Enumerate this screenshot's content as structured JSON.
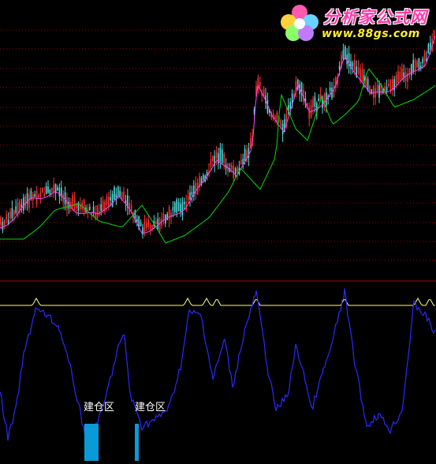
{
  "branding": {
    "site_name": "分析家公式网",
    "site_url": "www.88gs.com"
  },
  "signals": {
    "zone_label_1": "建仓区",
    "zone_label_2": "建仓区"
  },
  "colors": {
    "background": "#000000",
    "candle_up": "#ff3232",
    "candle_down": "#50e0e0",
    "ma_short": "#ff40ff",
    "ma_long": "#00dd00",
    "divider": "#b00000",
    "grid_dots": "#a00000",
    "oscillator": "#2a2aff",
    "ceiling_line": "#ffff80",
    "signal_bar": "#0a9ad8"
  }
}
